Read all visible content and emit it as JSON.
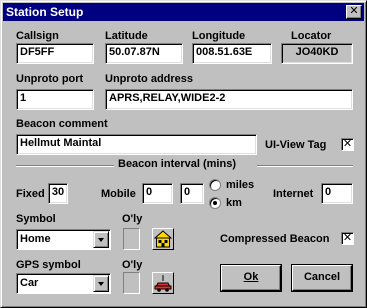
{
  "window": {
    "title": "Station Setup",
    "close_glyph": "✕"
  },
  "station": {
    "callsign_label": "Callsign",
    "callsign_value": "DF5FF",
    "latitude_label": "Latitude",
    "latitude_value": "50.07.87N",
    "longitude_label": "Longitude",
    "longitude_value": "008.51.63E",
    "locator_label": "Locator",
    "locator_value": "JO40KD"
  },
  "unproto": {
    "port_label": "Unproto port",
    "port_value": "1",
    "address_label": "Unproto address",
    "address_value": "APRS,RELAY,WIDE2-2"
  },
  "beacon": {
    "comment_label": "Beacon comment",
    "comment_value": "Hellmut Maintal",
    "uiview_tag_label": "UI-View Tag",
    "uiview_tag_checked": true,
    "check_glyph": "✕"
  },
  "interval": {
    "section_label": "Beacon interval (mins)",
    "fixed_label": "Fixed",
    "fixed_value": "30",
    "mobile_label": "Mobile",
    "mobile_value": "0",
    "mobile_distance_value": "0",
    "unit_miles_label": "miles",
    "unit_km_label": "km",
    "unit_selected": "km",
    "internet_label": "Internet",
    "internet_value": "0"
  },
  "symbol": {
    "label": "Symbol",
    "overlay_label": "O'ly",
    "value": "Home",
    "icon": "house-icon",
    "compressed_label": "Compressed Beacon",
    "compressed_checked": true
  },
  "gps_symbol": {
    "label": "GPS symbol",
    "overlay_label": "O'ly",
    "value": "Car",
    "icon": "car-icon"
  },
  "buttons": {
    "ok_label": "Ok",
    "cancel_label": "Cancel"
  },
  "colors": {
    "titlebar": "#000080",
    "face": "#c0c0c0",
    "house": "#ffd700",
    "car": "#e03030"
  }
}
